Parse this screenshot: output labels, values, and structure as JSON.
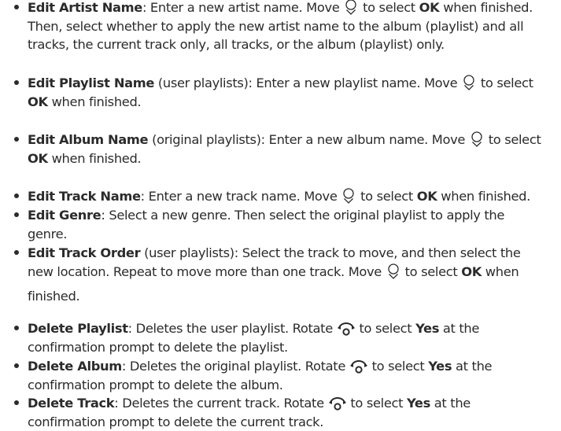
{
  "items": [
    {
      "term": "Edit Artist Name",
      "lines": [
        [
          ": Enter a new artist name. Move ",
          {
            "icon": "joystick-down-icon"
          },
          " to select ",
          {
            "b": "OK"
          },
          " when finished."
        ],
        [
          "Then, select whether to apply the new artist name to the album (playlist) and all"
        ],
        [
          "tracks, the current track only, all tracks, or the album (playlist) only."
        ]
      ]
    },
    {
      "term": "Edit Playlist Name",
      "lines": [
        [
          " (user playlists): Enter a new playlist name. Move ",
          {
            "icon": "joystick-down-icon"
          },
          " to select"
        ],
        [
          {
            "b": "OK"
          },
          " when finished."
        ]
      ]
    },
    {
      "term": "Edit Album Name",
      "lines": [
        [
          " (original playlists): Enter a new album name. Move ",
          {
            "icon": "joystick-down-icon"
          },
          " to select"
        ],
        [
          {
            "b": "OK"
          },
          " when finished."
        ]
      ]
    },
    {
      "term": "Edit Track Name",
      "lines": [
        [
          ": Enter a new track name. Move ",
          {
            "icon": "joystick-down-icon"
          },
          " to select ",
          {
            "b": "OK"
          },
          " when finished."
        ]
      ]
    },
    {
      "term": "Edit Genre",
      "lines": [
        [
          ": Select a new genre. Then select the original playlist to apply the"
        ],
        [
          "genre."
        ]
      ]
    },
    {
      "term": "Edit Track Order",
      "lines": [
        [
          " (user playlists): Select the track to move, and then select the"
        ],
        [
          "new location. Repeat to move more than one track. Move ",
          {
            "icon": "joystick-down-icon"
          },
          " to select ",
          {
            "b": "OK"
          },
          " when"
        ],
        [
          "finished."
        ]
      ]
    },
    {
      "term": "Delete Playlist",
      "lines": [
        [
          ": Deletes the user playlist. Rotate ",
          {
            "icon": "rotate-knob-icon"
          },
          " to select ",
          {
            "b": "Yes"
          },
          " at the"
        ],
        [
          "confirmation prompt to delete the playlist."
        ]
      ]
    },
    {
      "term": "Delete Album",
      "lines": [
        [
          ": Deletes the original playlist. Rotate ",
          {
            "icon": "rotate-knob-icon"
          },
          " to select ",
          {
            "b": "Yes"
          },
          " at the"
        ],
        [
          "confirmation prompt to delete the album."
        ]
      ]
    },
    {
      "term": "Delete Track",
      "lines": [
        [
          ": Deletes the current track. Rotate ",
          {
            "icon": "rotate-knob-icon"
          },
          " to select ",
          {
            "b": "Yes"
          },
          " at the"
        ],
        [
          "confirmation prompt to delete the current track."
        ]
      ]
    }
  ]
}
